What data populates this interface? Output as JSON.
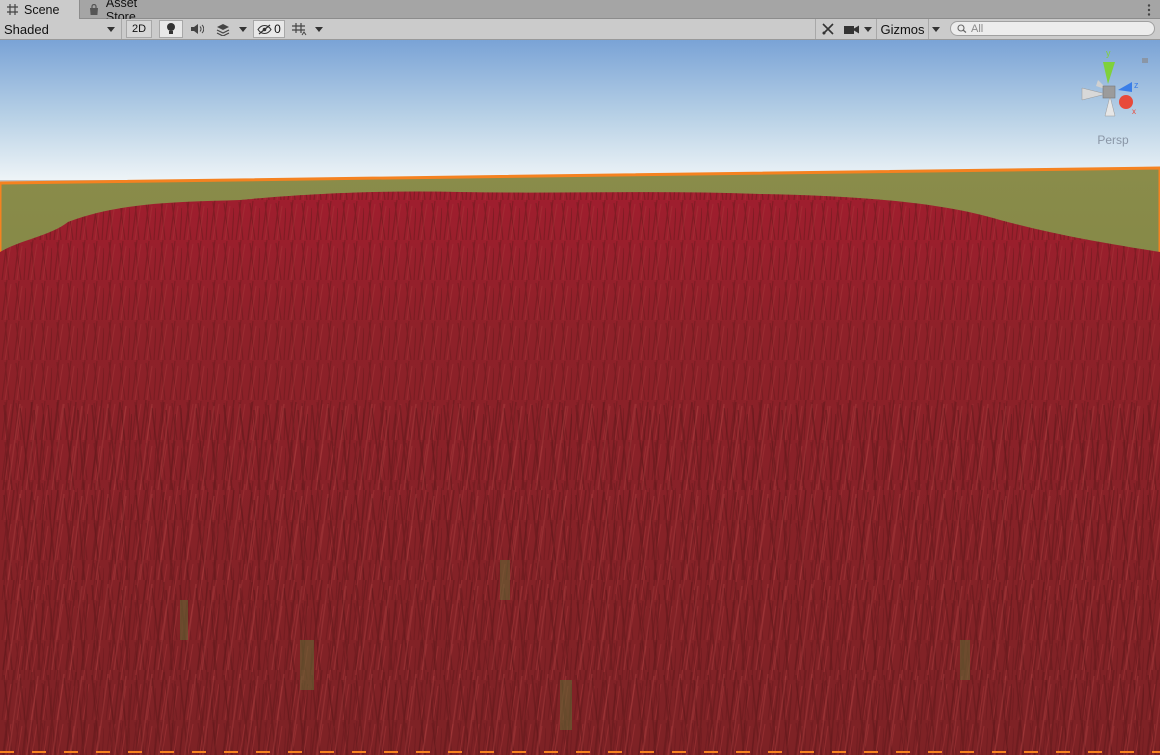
{
  "tabs": [
    {
      "label": "Scene",
      "icon": "grid-icon",
      "active": true
    },
    {
      "label": "Asset Store",
      "icon": "bag-icon",
      "active": false
    }
  ],
  "toolbar": {
    "draw_mode": "Shaded",
    "mode_2d_label": "2D",
    "hidden_count": "0",
    "gizmos_label": "Gizmos",
    "search_placeholder": "All"
  },
  "scene_gizmo": {
    "axes": [
      "y",
      "z",
      "x"
    ],
    "projection_label": "Persp",
    "colors": {
      "y": "#7fd13b",
      "z": "#3a7ee8",
      "x": "#e84a3a"
    }
  },
  "colors": {
    "sky_top": "#7aa3d6",
    "sky_horizon": "#e9f1f6",
    "ground": "#7b8240",
    "grass": "#8d2126",
    "selection_outline": "#f58220"
  }
}
